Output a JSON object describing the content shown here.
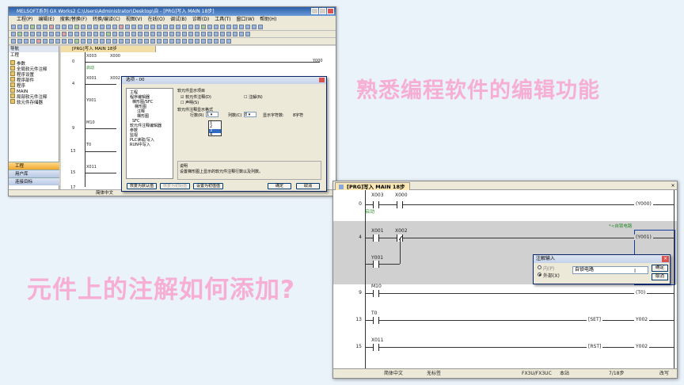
{
  "headings": {
    "title": "熟悉编程软件的编辑功能",
    "question": "元件上的注解如何添加?"
  },
  "window1": {
    "title": "MELSOFT系列 GX Works2 C:\\Users\\Administrator\\Desktop\\自 - [PRG]写入 MAIN 18步]",
    "menu": [
      "工程(P)",
      "编辑(E)",
      "搜索/替换(F)",
      "转换/编译(C)",
      "视图(V)",
      "在线(O)",
      "调试(B)",
      "诊断(D)",
      "工具(T)",
      "窗口(W)",
      "帮助(H)"
    ],
    "nav_header": "导航",
    "nav_subheader": "工程",
    "nav_tree": [
      "参数",
      "全局软元件注释",
      "程序设置",
      "程序部件",
      "程序",
      "MAIN",
      "局部软元件注释",
      "软元件存储器"
    ],
    "nav_buttons": [
      "工程",
      "用户库",
      "连接目标"
    ],
    "tab": "[PRG]写入 MAIN 18步",
    "status": "简体中文",
    "ladder": {
      "devices": [
        "X003",
        "X000",
        "X001",
        "X002",
        "Y001",
        "M10",
        "T0",
        "X011",
        "Y000"
      ],
      "steps": [
        "0",
        "4",
        "9",
        "13",
        "15",
        "17"
      ],
      "comment": "启动"
    }
  },
  "options_dialog": {
    "title": "选项 - 00",
    "tree": [
      "工程",
      "程序编辑器",
      "梯形图/SFC",
      "梯形图",
      "注释",
      "梯形图",
      "SFC",
      "软元件注释编辑器",
      "参数",
      "监视",
      "PLC读取/写入",
      "RUN中写入"
    ],
    "group_title": "软元件显示项目",
    "chk_comment": "软元件注释(D)",
    "chk_annotation": "注解(N)",
    "chk_stmt": "声明(S)",
    "section": "软元件注释显示格式",
    "rows_label": "行数(R)",
    "rows_value": "1",
    "cols_label": "列数(C)",
    "cols_value": "8",
    "font_label": "显示字符数:",
    "font_value": "8字符",
    "list": [
      "1",
      "2",
      "3",
      "4"
    ],
    "desc_title": "说明",
    "desc": "设置梯形图上显示的软元件注释行数以及列数。",
    "btn_default": "恢复为默认值",
    "btn_default2": "恢复为初始值",
    "btn_setdefault": "设置为初值值",
    "btn_ok": "确定",
    "btn_cancel": "取消"
  },
  "window2": {
    "tab": "[PRG]写入 MAIN 18步",
    "close": "×",
    "steps": [
      "0",
      "4",
      "9",
      "13",
      "15"
    ],
    "rung0": {
      "c1": "X003",
      "c2": "X000",
      "coil": "Y000",
      "comment": "启动"
    },
    "rung4": {
      "c1": "X001",
      "c2": "X002",
      "c3": "Y001",
      "coil": "Y001",
      "comment": "*<自锁电路"
    },
    "rung9": {
      "c1": "M10",
      "coil": "T0"
    },
    "rung13": {
      "c1": "T0",
      "op": "SET",
      "dev": "Y002"
    },
    "rung15": {
      "c1": "X011",
      "op": "RST",
      "dev": "Y002"
    },
    "status": {
      "lang": "简体中文",
      "label": "无标签",
      "cpu": "FX3U/FX3UC",
      "station": "本站",
      "steps": "7/18步",
      "mode": "改写"
    }
  },
  "comment_dialog": {
    "title": "注解输入",
    "close": "×",
    "radio1": "内(P)",
    "radio2": "外部(X)",
    "value": "自锁电路",
    "ok": "确定",
    "cancel": "取消"
  }
}
